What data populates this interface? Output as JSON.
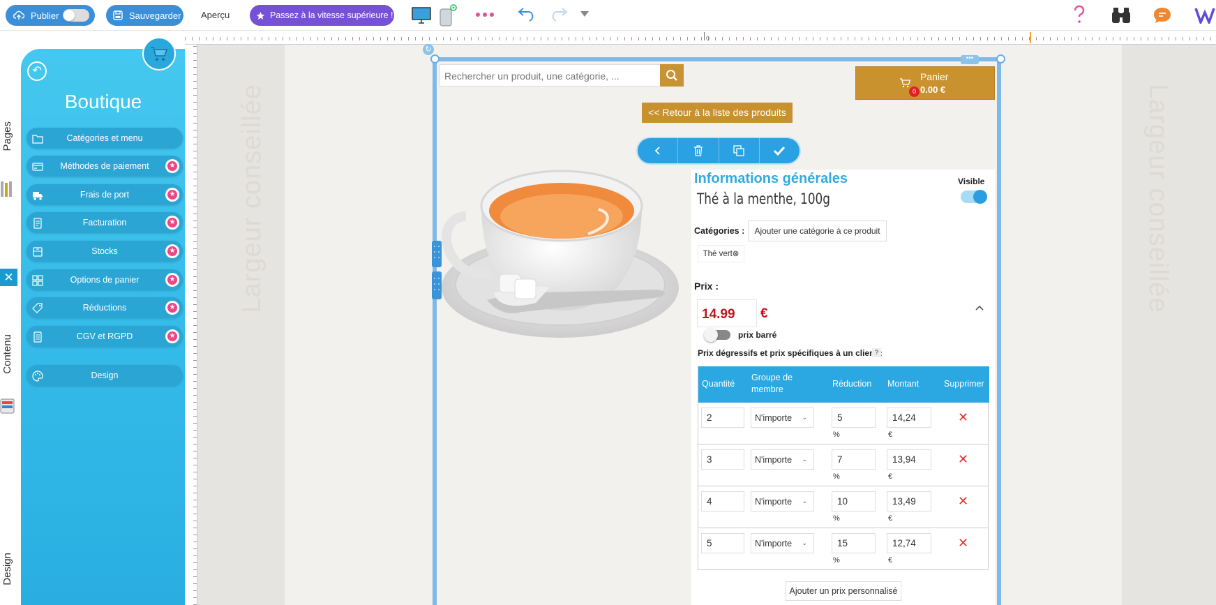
{
  "topbar": {
    "publish": "Publier",
    "save": "Sauvegarder",
    "preview": "Aperçu",
    "upgrade": "Passez à la vitesse supérieure !"
  },
  "ruler": {
    "zero": "0"
  },
  "left_tabs": {
    "pages": "Pages",
    "contenu": "Contenu",
    "design": "Design"
  },
  "sidebar": {
    "title": "Boutique",
    "items": [
      {
        "label": "Catégories et menu",
        "icon": "folder-icon",
        "premium": false
      },
      {
        "label": "Méthodes de paiement",
        "icon": "credit-card-icon",
        "premium": true
      },
      {
        "label": "Frais de port",
        "icon": "truck-icon",
        "premium": true
      },
      {
        "label": "Facturation",
        "icon": "invoice-icon",
        "premium": true
      },
      {
        "label": "Stocks",
        "icon": "stock-icon",
        "premium": true
      },
      {
        "label": "Options de panier",
        "icon": "grid-icon",
        "premium": true
      },
      {
        "label": "Réductions",
        "icon": "tag-icon",
        "premium": true
      },
      {
        "label": "CGV et RGPD",
        "icon": "document-icon",
        "premium": true
      },
      {
        "label": "Design",
        "icon": "palette-icon",
        "premium": false
      }
    ]
  },
  "canvas": {
    "recommended_width": "Largeur conseillée"
  },
  "shop": {
    "search_placeholder": "Rechercher un produit, une catégorie, ...",
    "cart_label": "Panier",
    "cart_total": "0.00 €",
    "cart_count": "0",
    "back_to_list": "<< Retour à la liste des produits"
  },
  "product": {
    "section_title": "Informations générales",
    "name": "Thé à la menthe, 100g",
    "visible_label": "Visible",
    "visible": true,
    "categories_label": "Catégories :",
    "add_category": "Ajouter une catégorie à ce produit",
    "category_tag": "Thé vert",
    "price_label": "Prix :",
    "price": "14.99",
    "currency": "€",
    "strikethrough_label": "prix barré",
    "tiered_label": "Prix dégressifs et prix spécifiques à un client :",
    "help": "?",
    "table": {
      "headers": {
        "qty": "Quantité",
        "group": "Groupe de membre",
        "reduction": "Réduction",
        "amount": "Montant",
        "delete": "Supprimer"
      },
      "rows": [
        {
          "qty": "2",
          "group": "N'importe",
          "reduction": "5",
          "amount": "14,24",
          "pct": "%",
          "cur": "€"
        },
        {
          "qty": "3",
          "group": "N'importe",
          "reduction": "7",
          "amount": "13,94",
          "pct": "%",
          "cur": "€"
        },
        {
          "qty": "4",
          "group": "N'importe",
          "reduction": "10",
          "amount": "13,49",
          "pct": "%",
          "cur": "€"
        },
        {
          "qty": "5",
          "group": "N'importe",
          "reduction": "15",
          "amount": "12,74",
          "pct": "%",
          "cur": "€"
        }
      ]
    },
    "add_custom_price": "Ajouter un prix personnalisé"
  },
  "colors": {
    "accent": "#3a8fd8",
    "upgrade": "#7750d8",
    "sidebar": "#33b9e8",
    "gold": "#c8912f",
    "price_red": "#c0141e",
    "table_header": "#2ba7e2"
  }
}
